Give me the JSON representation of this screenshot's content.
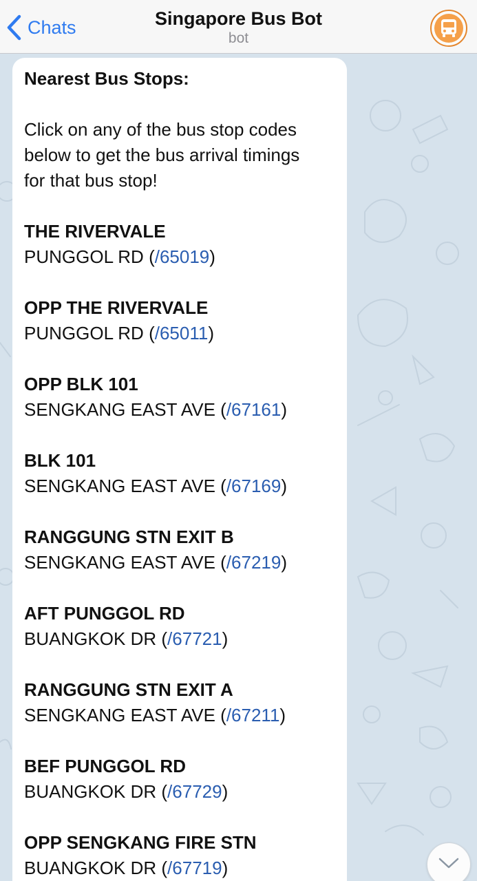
{
  "header": {
    "back_label": "Chats",
    "title": "Singapore Bus Bot",
    "subtitle": "bot"
  },
  "message": {
    "heading": "Nearest Bus Stops:",
    "intro_lines": [
      "Click on any of the bus stop codes",
      "below to get the bus arrival timings",
      "for that bus stop!"
    ],
    "stops": [
      {
        "name": "THE RIVERVALE",
        "road": "PUNGGOL RD",
        "code": "/65019"
      },
      {
        "name": "OPP THE RIVERVALE",
        "road": "PUNGGOL RD",
        "code": "/65011"
      },
      {
        "name": "OPP BLK 101",
        "road": "SENGKANG EAST AVE",
        "code": "/67161"
      },
      {
        "name": "BLK 101",
        "road": "SENGKANG EAST AVE",
        "code": "/67169"
      },
      {
        "name": "RANGGUNG STN EXIT B",
        "road": "SENGKANG EAST AVE",
        "code": "/67219"
      },
      {
        "name": "AFT PUNGGOL RD",
        "road": "BUANGKOK DR",
        "code": "/67721"
      },
      {
        "name": "RANGGUNG STN EXIT A",
        "road": "SENGKANG EAST AVE",
        "code": "/67211"
      },
      {
        "name": "BEF PUNGGOL RD",
        "road": "BUANGKOK DR",
        "code": "/67729"
      },
      {
        "name": "OPP SENGKANG FIRE STN",
        "road": "BUANGKOK DR",
        "code": "/67719"
      }
    ]
  },
  "colors": {
    "accent": "#2f7bf0",
    "link": "#2a5db0",
    "avatar_ring": "#e4862d",
    "chat_background": "#d6e2ec"
  },
  "icons": {
    "back": "chevron-left-icon",
    "avatar": "bus-icon",
    "scroll": "chevron-down-icon"
  }
}
